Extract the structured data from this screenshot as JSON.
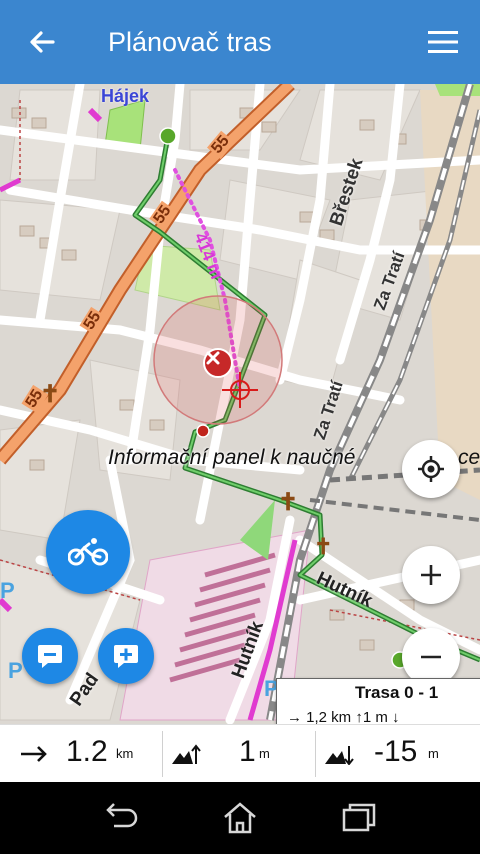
{
  "appbar": {
    "title": "Plánovač tras",
    "back_icon": "arrow-left-icon",
    "menu_icon": "hamburger-menu-icon"
  },
  "map": {
    "labels": {
      "hajek": "Hájek",
      "brestek": "Břestek",
      "za_trati_1": "Za Tratí",
      "za_trati_2": "Za Tratí",
      "hutnik_1": "Hutník",
      "hutnik_2": "Hutník",
      "pad": "Pad",
      "info": "Informační panel k naučné",
      "info_tail": "ce",
      "dist": "414 m",
      "road_55a": "55",
      "road_55b": "55",
      "road_55c": "55",
      "road_55d": "55",
      "road_55e": "55",
      "parking": "P"
    },
    "colors": {
      "route": "#2e7d32",
      "road": "#f4a26b",
      "accent": "#1e88e5"
    }
  },
  "route_card": {
    "title": "Trasa 0 - 1",
    "summary": "→ 1,2 km ↑1 m ↓"
  },
  "stats": {
    "distance": {
      "value": "1.2",
      "unit": "km",
      "icon": "arrow-right-icon"
    },
    "ascent": {
      "value": "1",
      "unit": "m",
      "icon": "elevation-up-icon"
    },
    "descent": {
      "value": "-15",
      "unit": "m",
      "icon": "elevation-down-icon"
    }
  },
  "nav": {
    "back": "nav-back-icon",
    "home": "nav-home-icon",
    "recents": "nav-recents-icon"
  }
}
